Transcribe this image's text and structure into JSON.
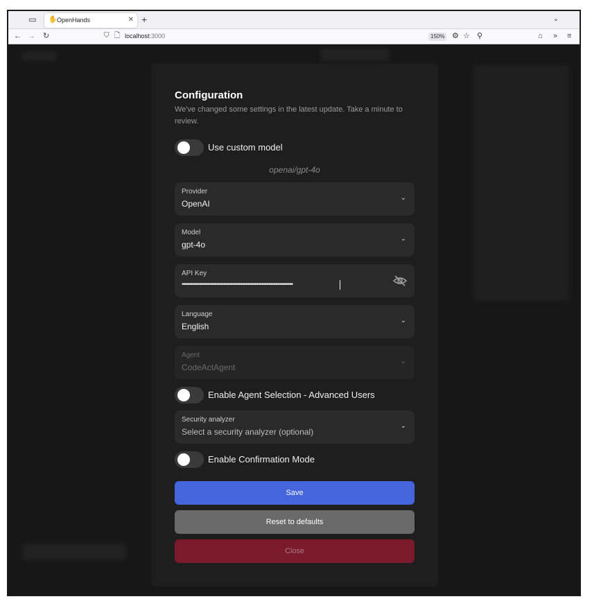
{
  "browser": {
    "tab_title": "OpenHands",
    "url_host": "localhost",
    "url_port": ":3000",
    "zoom": "150%"
  },
  "modal": {
    "title": "Configuration",
    "description": "We've changed some settings in the latest update. Take a minute to review.",
    "custom_model_toggle": {
      "label": "Use custom model",
      "on": false
    },
    "model_hint": "openai/gpt-4o",
    "fields": {
      "provider": {
        "label": "Provider",
        "value": "OpenAI"
      },
      "model": {
        "label": "Model",
        "value": "gpt-4o"
      },
      "api_key": {
        "label": "API Key",
        "value": "••••••••••••••••••••••••••••••••••••••••••••••••••••••••••••••••"
      },
      "language": {
        "label": "Language",
        "value": "English"
      },
      "agent": {
        "label": "Agent",
        "value": "CodeActAgent"
      },
      "security_analyzer": {
        "label": "Security analyzer",
        "placeholder": "Select a security analyzer (optional)"
      }
    },
    "agent_selection_toggle": {
      "label": "Enable Agent Selection - Advanced Users",
      "on": false
    },
    "confirmation_toggle": {
      "label": "Enable Confirmation Mode",
      "on": false
    },
    "buttons": {
      "save": "Save",
      "reset": "Reset to defaults",
      "close": "Close"
    }
  },
  "colors": {
    "save": "#4465db",
    "reset": "#6a6a6a",
    "close": "#7a1a2a",
    "modal_bg": "#1e1e1e",
    "field_bg": "#2a2a2a"
  }
}
